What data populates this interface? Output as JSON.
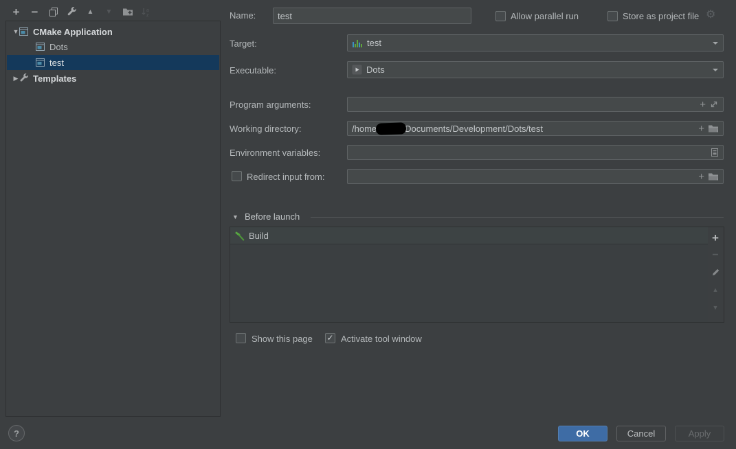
{
  "colors": {
    "background": "#3c3f41",
    "selection_blue": "#14395b",
    "ok_blue": "#3e6ca5",
    "build_green": "#58a942",
    "target_bar_blue": "#3b92c0",
    "target_bar_green": "#5ea53c"
  },
  "toolbar": {
    "icons": [
      {
        "name": "add-icon",
        "glyph": "+"
      },
      {
        "name": "remove-icon",
        "glyph": "−"
      },
      {
        "name": "copy-icon"
      },
      {
        "name": "wrench-icon"
      },
      {
        "name": "move-up-icon",
        "glyph": "▲"
      },
      {
        "name": "move-down-icon",
        "glyph": "▼"
      },
      {
        "name": "new-folder-icon"
      },
      {
        "name": "sort-alphabetically-icon"
      }
    ]
  },
  "tree": {
    "items": [
      {
        "label": "CMake Application",
        "icon": "application-icon",
        "expanded": true,
        "level": 0
      },
      {
        "label": "Dots",
        "icon": "application-icon",
        "level": 1
      },
      {
        "label": "test",
        "icon": "application-icon",
        "level": 1,
        "selected": true
      },
      {
        "label": "Templates",
        "icon": "wrench-icon",
        "expanded": false,
        "level": 0
      }
    ]
  },
  "form": {
    "name_label": "Name:",
    "name_value": "test",
    "allow_parallel_run_label": "Allow parallel run",
    "allow_parallel_run_checked": false,
    "store_as_project_file_label": "Store as project file",
    "store_as_project_file_checked": false,
    "target_label": "Target:",
    "target_value": "test",
    "executable_label": "Executable:",
    "executable_value": "Dots",
    "program_arguments_label": "Program arguments:",
    "program_arguments_value": "",
    "working_directory_label": "Working directory:",
    "working_directory_prefix": "/home",
    "working_directory_suffix": "Documents/Development/Dots/test",
    "environment_variables_label": "Environment variables:",
    "environment_variables_value": "",
    "redirect_input_label": "Redirect input from:",
    "redirect_input_checked": false,
    "redirect_input_value": ""
  },
  "before_launch": {
    "title": "Before launch",
    "items": [
      {
        "label": "Build",
        "icon": "hammer-icon"
      }
    ],
    "side_buttons": [
      "add-icon",
      "remove-icon",
      "edit-pencil-icon",
      "move-up-icon",
      "move-down-icon"
    ]
  },
  "footer": {
    "show_this_page_label": "Show this page",
    "show_this_page_checked": false,
    "activate_tool_window_label": "Activate tool window",
    "activate_tool_window_checked": true,
    "ok_label": "OK",
    "cancel_label": "Cancel",
    "apply_label": "Apply",
    "help_label": "?"
  }
}
